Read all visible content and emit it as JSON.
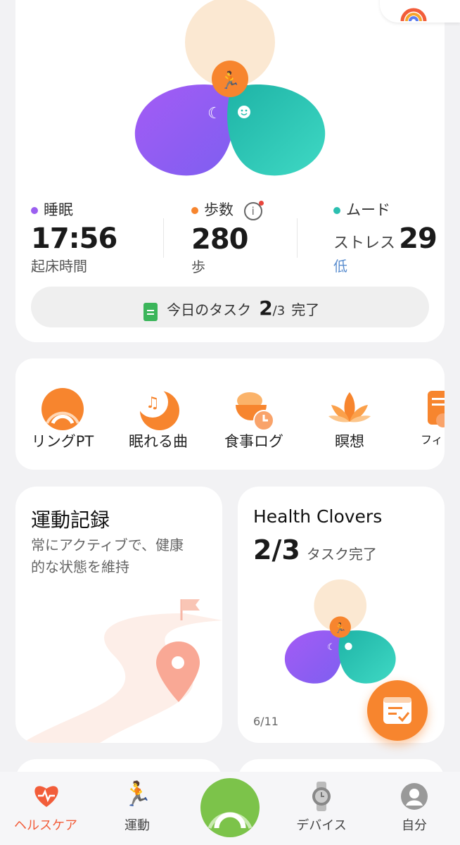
{
  "colors": {
    "orange": "#f7852e",
    "purple": "#9b5ff0",
    "teal": "#2bbfb0",
    "light": "#fbe8d2",
    "blue_text": "#5b8ecf"
  },
  "summary": {
    "sleep": {
      "label": "睡眠",
      "value": "17:56",
      "sub": "起床時間"
    },
    "steps": {
      "label": "歩数",
      "value": "280",
      "sub": "歩"
    },
    "mood": {
      "label": "ムード",
      "stress_label": "ストレス",
      "stress_value": "29",
      "sub": "低"
    },
    "task": {
      "prefix": "今日のタスク",
      "done": "2",
      "total": "/3",
      "suffix": "完了"
    }
  },
  "shortcuts": [
    {
      "label": "リングPT",
      "icon": "ring-icon"
    },
    {
      "label": "眠れる曲",
      "icon": "sleep-music-icon"
    },
    {
      "label": "食事ログ",
      "icon": "meal-log-icon"
    },
    {
      "label": "瞑想",
      "icon": "lotus-icon"
    },
    {
      "label": "フィッ",
      "icon": "fitness-icon"
    }
  ],
  "exercise": {
    "title": "運動記録",
    "desc_line1": "常にアクティブで、健康",
    "desc_line2": "的な状態を維持"
  },
  "clovers": {
    "title": "Health Clovers",
    "done": "2/3",
    "suffix": "タスク完了",
    "date": "6/11"
  },
  "tabs": [
    {
      "label": "ヘルスケア",
      "icon": "heart-icon",
      "active": true
    },
    {
      "label": "運動",
      "icon": "running-icon"
    },
    {
      "label": "",
      "icon": "ring-center-icon"
    },
    {
      "label": "デバイス",
      "icon": "watch-icon"
    },
    {
      "label": "自分",
      "icon": "profile-icon"
    }
  ]
}
